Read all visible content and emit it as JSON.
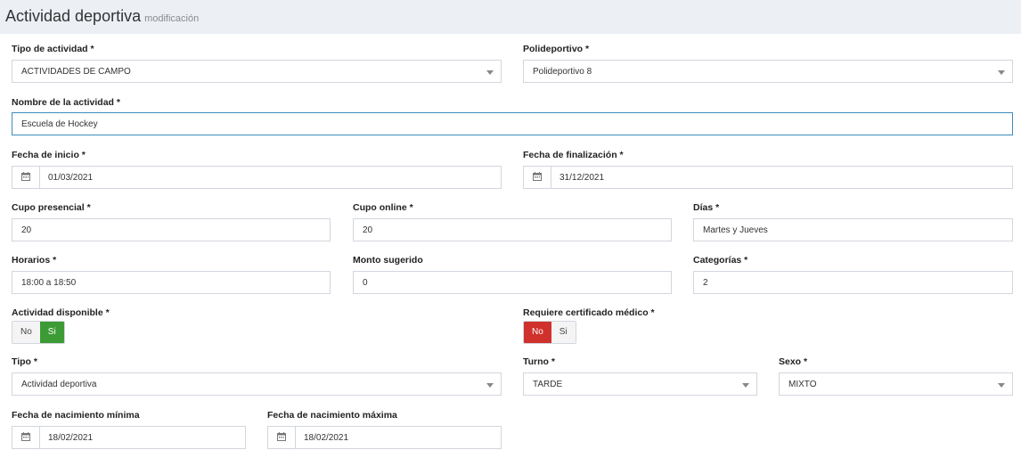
{
  "header": {
    "title": "Actividad deportiva",
    "subtitle": "modificación"
  },
  "fields": {
    "tipo_actividad": {
      "label": "Tipo de actividad *",
      "value": "ACTIVIDADES DE CAMPO"
    },
    "polideportivo": {
      "label": "Polideportivo *",
      "value": "Polideportivo 8"
    },
    "nombre": {
      "label": "Nombre de la actividad *",
      "value": "Escuela de Hockey"
    },
    "fecha_inicio": {
      "label": "Fecha de inicio *",
      "value": "01/03/2021"
    },
    "fecha_fin": {
      "label": "Fecha de finalización *",
      "value": "31/12/2021"
    },
    "cupo_presencial": {
      "label": "Cupo presencial *",
      "value": "20"
    },
    "cupo_online": {
      "label": "Cupo online *",
      "value": "20"
    },
    "dias": {
      "label": "Días *",
      "value": "Martes y Jueves"
    },
    "horarios": {
      "label": "Horarios *",
      "value": "18:00 a 18:50"
    },
    "monto": {
      "label": "Monto sugerido",
      "value": "0"
    },
    "categorias": {
      "label": "Categorías *",
      "value": "2"
    },
    "disponible": {
      "label": "Actividad disponible *",
      "no": "No",
      "si": "Si",
      "selected": "Si"
    },
    "certificado": {
      "label": "Requiere certificado médico *",
      "no": "No",
      "si": "Si",
      "selected": "No"
    },
    "tipo": {
      "label": "Tipo *",
      "value": "Actividad deportiva"
    },
    "turno": {
      "label": "Turno *",
      "value": "TARDE"
    },
    "sexo": {
      "label": "Sexo *",
      "value": "MIXTO"
    },
    "nac_min": {
      "label": "Fecha de nacimiento mínima",
      "value": "18/02/2021"
    },
    "nac_max": {
      "label": "Fecha de nacimiento máxima",
      "value": "18/02/2021"
    }
  },
  "icons": {
    "calendar": "calendar-icon",
    "dropdown": "chevron-down-icon"
  },
  "colors": {
    "focus_border": "#3c8dbc",
    "toggle_on_green": "#3d9b35",
    "toggle_on_red": "#d0312d",
    "page_bg": "#ecf0f5"
  }
}
